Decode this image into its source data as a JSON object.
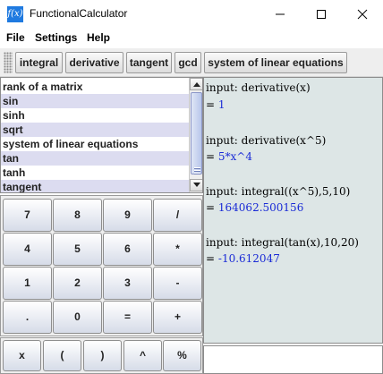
{
  "window": {
    "title": "FunctionalCalculator",
    "icon": "f(x)"
  },
  "menu": [
    "File",
    "Settings",
    "Help"
  ],
  "toolbar": {
    "buttons": [
      "integral",
      "derivative",
      "tangent",
      "gcd",
      "system of linear equations"
    ]
  },
  "function_list": {
    "items": [
      "rank of a matrix",
      "sin",
      "sinh",
      "sqrt",
      "system of linear equations",
      "tan",
      "tanh",
      "tangent"
    ]
  },
  "keypad": {
    "rows": [
      [
        "7",
        "8",
        "9",
        "/"
      ],
      [
        "4",
        "5",
        "6",
        "*"
      ],
      [
        "1",
        "2",
        "3",
        "-"
      ],
      [
        ".",
        "0",
        "=",
        "+"
      ]
    ],
    "extra": [
      "x",
      "(",
      ")",
      "^",
      "%"
    ]
  },
  "output": {
    "entries": [
      {
        "input": "input: derivative(x)",
        "result": "1"
      },
      {
        "input": "input: derivative(x^5)",
        "result": "5*x^4"
      },
      {
        "input": "input: integral((x^5),5,10)",
        "result": "164062.500156"
      },
      {
        "input": "input: integral(tan(x),10,20)",
        "result": "-10.612047"
      }
    ],
    "result_prefix": "="
  },
  "colors": {
    "result_text": "#1a2bd6",
    "list_alt_row": "#dcdcf0",
    "output_bg": "#dde6e6"
  }
}
